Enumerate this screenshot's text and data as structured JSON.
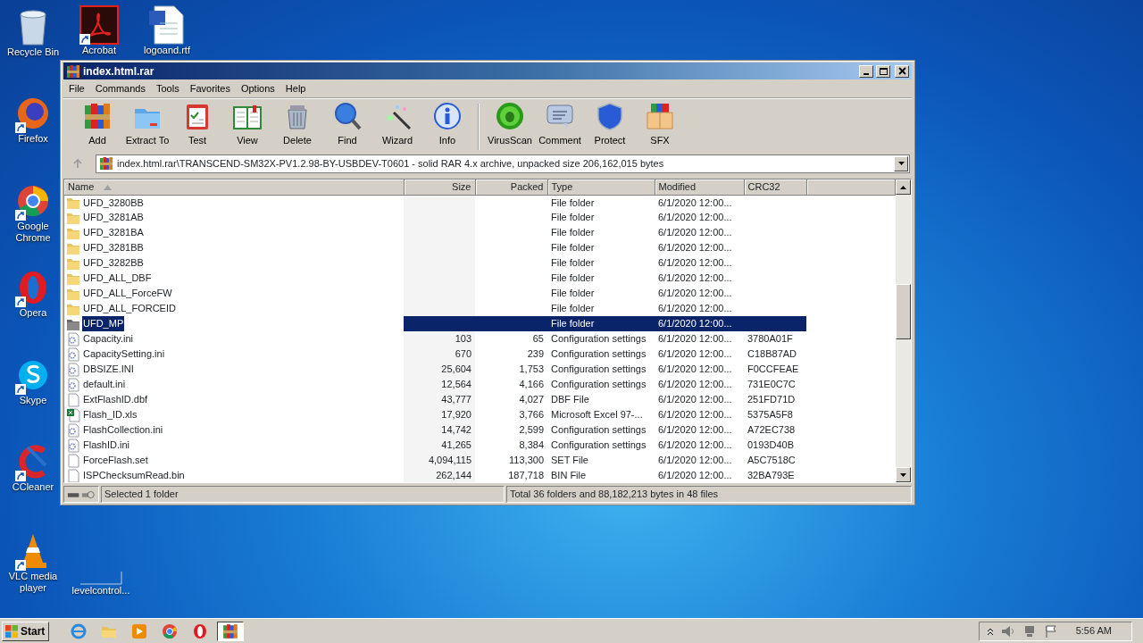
{
  "desktop": {
    "column_icons": [
      {
        "label": "Recycle Bin",
        "kind": "trash",
        "shortcut": false
      },
      {
        "label": "Firefox",
        "kind": "firefox",
        "shortcut": true
      },
      {
        "label": "Google Chrome",
        "kind": "chrome",
        "shortcut": true
      },
      {
        "label": "Opera",
        "kind": "opera",
        "shortcut": true
      },
      {
        "label": "Skype",
        "kind": "skype",
        "shortcut": true
      },
      {
        "label": "CCleaner",
        "kind": "ccleaner",
        "shortcut": true
      },
      {
        "label": "VLC media player",
        "kind": "vlc",
        "shortcut": true
      },
      {
        "label": "levelcontrol...",
        "kind": "blank",
        "shortcut": false
      }
    ],
    "row_icons": [
      {
        "label": "Acrobat",
        "kind": "acrobat",
        "shortcut": true
      },
      {
        "label": "logoand.rtf",
        "kind": "word",
        "shortcut": false
      }
    ]
  },
  "window": {
    "title": "index.html.rar",
    "menu": [
      "File",
      "Commands",
      "Tools",
      "Favorites",
      "Options",
      "Help"
    ],
    "toolbar_groups": [
      {
        "buttons": [
          {
            "label": "Add",
            "kind": "add"
          },
          {
            "label": "Extract To",
            "kind": "extract"
          },
          {
            "label": "Test",
            "kind": "test"
          },
          {
            "label": "View",
            "kind": "view"
          },
          {
            "label": "Delete",
            "kind": "delete"
          },
          {
            "label": "Find",
            "kind": "find"
          },
          {
            "label": "Wizard",
            "kind": "wizard"
          },
          {
            "label": "Info",
            "kind": "info"
          }
        ]
      },
      {
        "buttons": [
          {
            "label": "VirusScan",
            "kind": "virusscan"
          },
          {
            "label": "Comment",
            "kind": "comment"
          },
          {
            "label": "Protect",
            "kind": "protect"
          },
          {
            "label": "SFX",
            "kind": "sfx"
          }
        ]
      }
    ],
    "address": "index.html.rar\\TRANSCEND-SM32X-PV1.2.98-BY-USBDEV-T0601 - solid RAR 4.x archive, unpacked size 206,162,015 bytes",
    "table": {
      "columns": [
        "Name",
        "Size",
        "Packed",
        "Type",
        "Modified",
        "CRC32"
      ],
      "rows": [
        {
          "name": "UFD_3280BB",
          "size": "",
          "packed": "",
          "type": "File folder",
          "modified": "6/1/2020 12:00...",
          "crc": "",
          "kind": "folder",
          "selected": false
        },
        {
          "name": "UFD_3281AB",
          "size": "",
          "packed": "",
          "type": "File folder",
          "modified": "6/1/2020 12:00...",
          "crc": "",
          "kind": "folder",
          "selected": false
        },
        {
          "name": "UFD_3281BA",
          "size": "",
          "packed": "",
          "type": "File folder",
          "modified": "6/1/2020 12:00...",
          "crc": "",
          "kind": "folder",
          "selected": false
        },
        {
          "name": "UFD_3281BB",
          "size": "",
          "packed": "",
          "type": "File folder",
          "modified": "6/1/2020 12:00...",
          "crc": "",
          "kind": "folder",
          "selected": false
        },
        {
          "name": "UFD_3282BB",
          "size": "",
          "packed": "",
          "type": "File folder",
          "modified": "6/1/2020 12:00...",
          "crc": "",
          "kind": "folder",
          "selected": false
        },
        {
          "name": "UFD_ALL_DBF",
          "size": "",
          "packed": "",
          "type": "File folder",
          "modified": "6/1/2020 12:00...",
          "crc": "",
          "kind": "folder",
          "selected": false
        },
        {
          "name": "UFD_ALL_ForceFW",
          "size": "",
          "packed": "",
          "type": "File folder",
          "modified": "6/1/2020 12:00...",
          "crc": "",
          "kind": "folder",
          "selected": false
        },
        {
          "name": "UFD_ALL_FORCEID",
          "size": "",
          "packed": "",
          "type": "File folder",
          "modified": "6/1/2020 12:00...",
          "crc": "",
          "kind": "folder",
          "selected": false
        },
        {
          "name": "UFD_MP",
          "size": "",
          "packed": "",
          "type": "File folder",
          "modified": "6/1/2020 12:00...",
          "crc": "",
          "kind": "folder",
          "selected": true
        },
        {
          "name": "Capacity.ini",
          "size": "103",
          "packed": "65",
          "type": "Configuration settings",
          "modified": "6/1/2020 12:00...",
          "crc": "3780A01F",
          "kind": "ini",
          "selected": false
        },
        {
          "name": "CapacitySetting.ini",
          "size": "670",
          "packed": "239",
          "type": "Configuration settings",
          "modified": "6/1/2020 12:00...",
          "crc": "C18B87AD",
          "kind": "ini",
          "selected": false
        },
        {
          "name": "DBSIZE.INI",
          "size": "25,604",
          "packed": "1,753",
          "type": "Configuration settings",
          "modified": "6/1/2020 12:00...",
          "crc": "F0CCFEAE",
          "kind": "ini",
          "selected": false
        },
        {
          "name": "default.ini",
          "size": "12,564",
          "packed": "4,166",
          "type": "Configuration settings",
          "modified": "6/1/2020 12:00...",
          "crc": "731E0C7C",
          "kind": "ini",
          "selected": false
        },
        {
          "name": "ExtFlashID.dbf",
          "size": "43,777",
          "packed": "4,027",
          "type": "DBF File",
          "modified": "6/1/2020 12:00...",
          "crc": "251FD71D",
          "kind": "file",
          "selected": false
        },
        {
          "name": "Flash_ID.xls",
          "size": "17,920",
          "packed": "3,766",
          "type": "Microsoft Excel 97-...",
          "modified": "6/1/2020 12:00...",
          "crc": "5375A5F8",
          "kind": "xls",
          "selected": false
        },
        {
          "name": "FlashCollection.ini",
          "size": "14,742",
          "packed": "2,599",
          "type": "Configuration settings",
          "modified": "6/1/2020 12:00...",
          "crc": "A72EC738",
          "kind": "ini",
          "selected": false
        },
        {
          "name": "FlashID.ini",
          "size": "41,265",
          "packed": "8,384",
          "type": "Configuration settings",
          "modified": "6/1/2020 12:00...",
          "crc": "0193D40B",
          "kind": "ini",
          "selected": false
        },
        {
          "name": "ForceFlash.set",
          "size": "4,094,115",
          "packed": "113,300",
          "type": "SET File",
          "modified": "6/1/2020 12:00...",
          "crc": "A5C7518C",
          "kind": "file",
          "selected": false
        },
        {
          "name": "ISPChecksumRead.bin",
          "size": "262,144",
          "packed": "187,718",
          "type": "BIN File",
          "modified": "6/1/2020 12:00...",
          "crc": "32BA793E",
          "kind": "file",
          "selected": false
        }
      ]
    },
    "status_bar": {
      "left": "Selected 1 folder",
      "right": "Total 36 folders and 88,182,213 bytes in 48 files"
    }
  },
  "taskbar": {
    "start": "Start",
    "apps": [
      {
        "kind": "ie",
        "selected": false
      },
      {
        "kind": "explorer",
        "selected": false
      },
      {
        "kind": "media",
        "selected": false
      },
      {
        "kind": "chrome",
        "selected": false
      },
      {
        "kind": "opera",
        "selected": false
      },
      {
        "kind": "winrar",
        "selected": true
      }
    ],
    "clock": "5:56 AM"
  }
}
